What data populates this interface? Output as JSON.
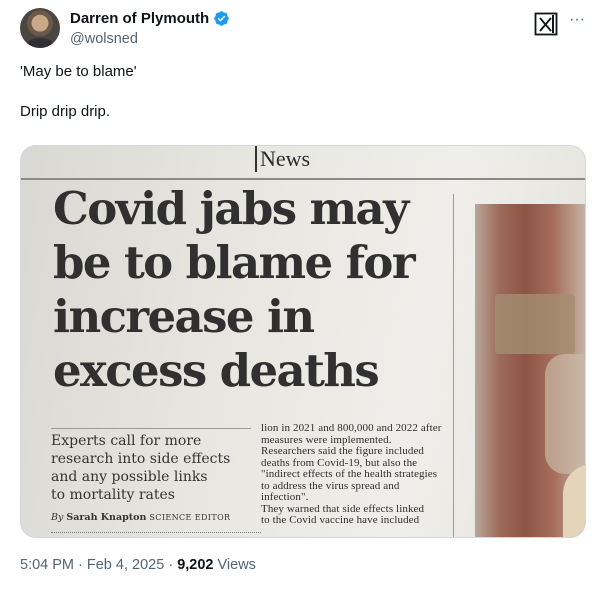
{
  "author": {
    "name": "Darren of Plymouth",
    "handle": "@wolsned",
    "verified": true,
    "verified_color": "#1d9bf0"
  },
  "header_actions": {
    "grok_icon": "grok-icon",
    "more_icon": "more-icon",
    "more_label": "···"
  },
  "tweet": {
    "text": "'May be to blame'\n\nDrip drip drip."
  },
  "media": {
    "section": "News",
    "headline": "Covid jabs may\nbe to blame for\nincrease in\nexcess deaths",
    "subheading": "Experts call for more\nresearch into side effects\nand any possible links\nto mortality rates",
    "byline_prefix": "By",
    "byline_name": "Sarah Knapton",
    "byline_role": "SCIENCE EDITOR",
    "body": "lion in 2021 and 800,000 and 2022 after\nmeasures were implemented.\n   Researchers said the figure included\ndeaths from Covid-19, but also the\n\"indirect effects of the health strategies\nto address the virus spread and\ninfection\".\n   They warned that side effects linked\nto the Covid vaccine have included"
  },
  "meta": {
    "time": "5:04 PM",
    "separator": " · ",
    "date": "Feb 4, 2025",
    "views_count": "9,202",
    "views_label": "Views"
  }
}
